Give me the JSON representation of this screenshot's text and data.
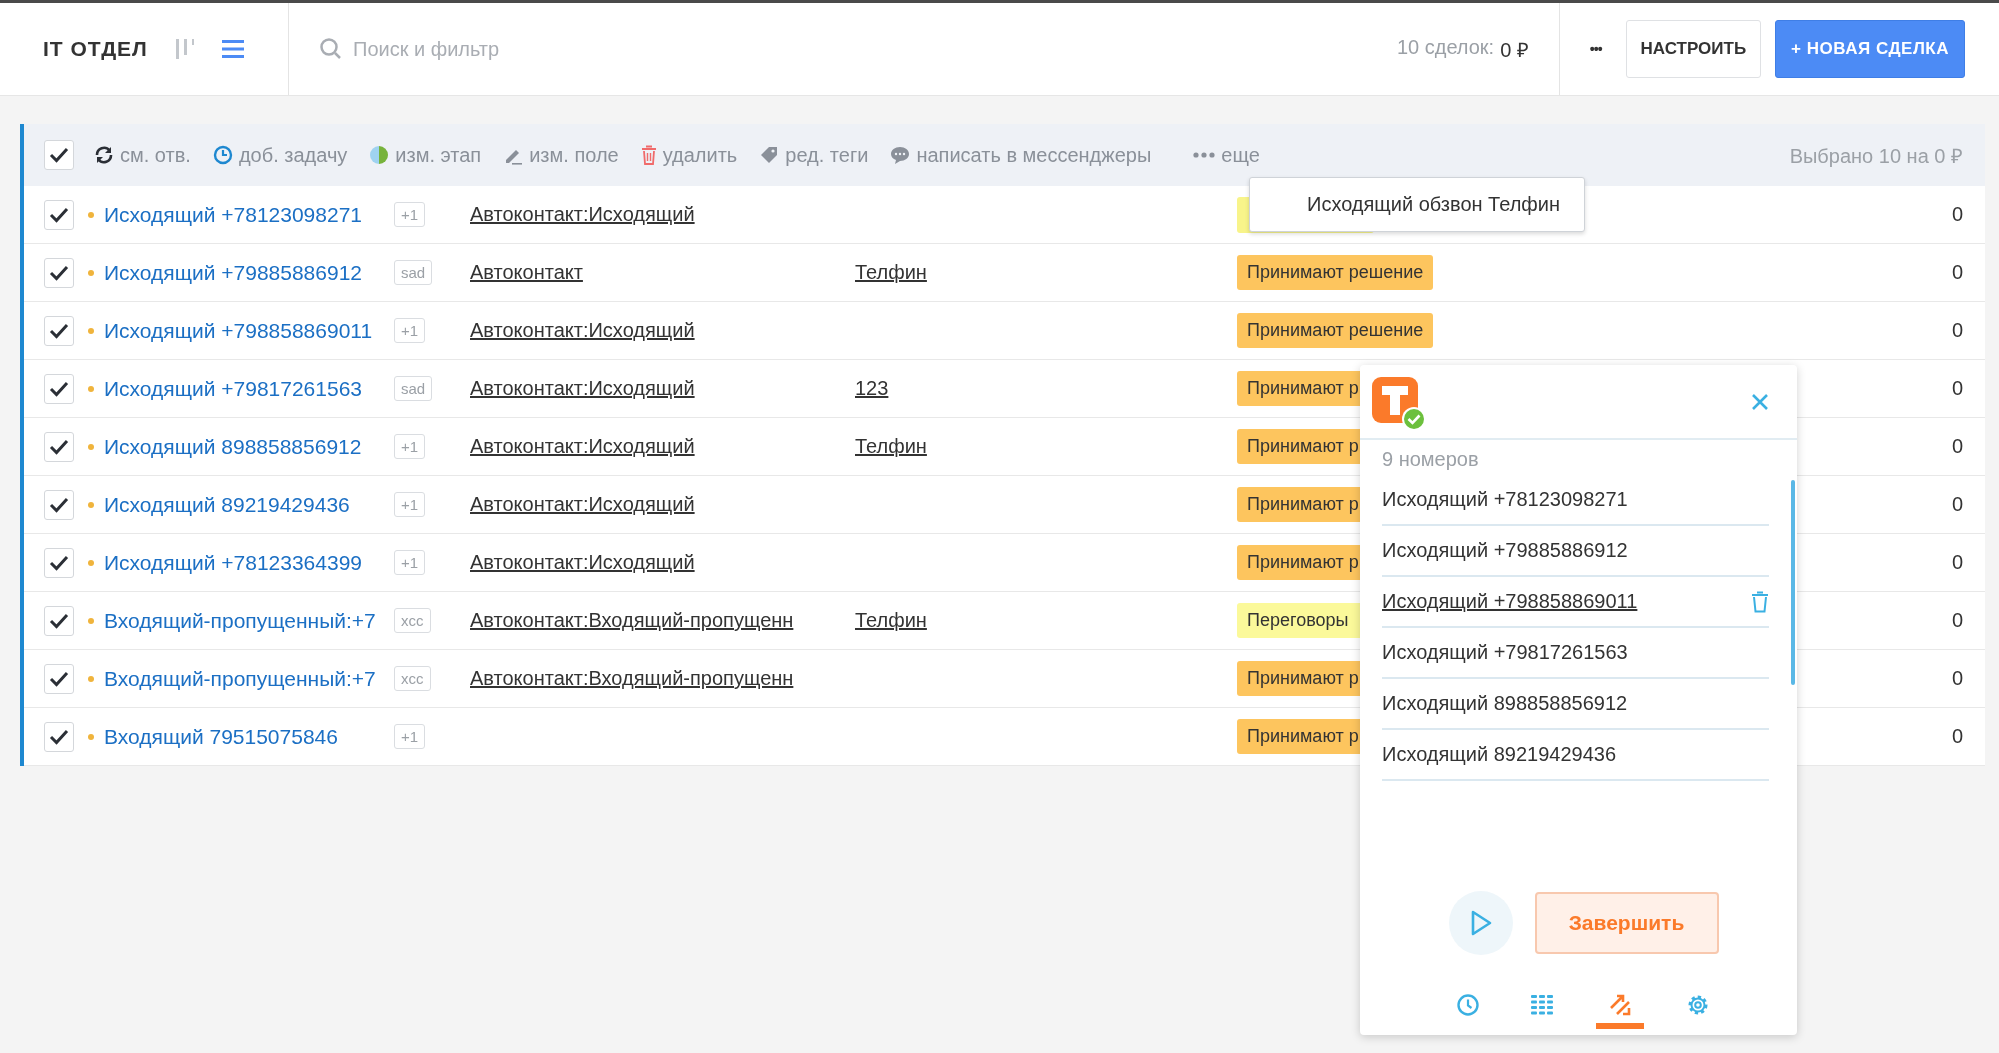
{
  "header": {
    "title": "IT ОТДЕЛ",
    "view_modes": [
      {
        "kind": "pipeline",
        "selected": false
      },
      {
        "kind": "list",
        "selected": true
      }
    ],
    "search": {
      "placeholder": "Поиск и фильтр"
    },
    "summary": {
      "label": "10 сделок:",
      "value": "0 ₽"
    },
    "more_button": "•••",
    "settings_button": "НАСТРОИТЬ",
    "new_deal_button": "+ НОВАЯ СДЕЛКА"
  },
  "bulk_toolbar": {
    "select_all_checked": true,
    "actions": [
      {
        "kind": "reassign",
        "label": "см. отв."
      },
      {
        "kind": "task",
        "label": "доб. задачу"
      },
      {
        "kind": "stage",
        "label": "изм. этап"
      },
      {
        "kind": "field",
        "label": "изм. поле"
      },
      {
        "kind": "delete",
        "label": "удалить"
      },
      {
        "kind": "tags",
        "label": "ред. теги"
      },
      {
        "kind": "messenger",
        "label": "написать в мессенджеры"
      },
      {
        "kind": "more",
        "label": "еще"
      }
    ],
    "selection_summary": "Выбрано 10 на 0 ₽"
  },
  "dropdown": {
    "items": [
      "Исходящий обзвон Телфин"
    ]
  },
  "rows": [
    {
      "checked": true,
      "name": "Исходящий +78123098271",
      "tag": "+1",
      "contact": "Автоконтакт:Исходящий",
      "column_3": "",
      "status": "",
      "color": "#f8f48a",
      "amount": "0"
    },
    {
      "checked": true,
      "name": "Исходящий +79885886912",
      "tag": "sad",
      "contact": "Автоконтакт",
      "column_3": "Телфин",
      "status": "Принимают решение",
      "color": "#fdc55e",
      "amount": "0"
    },
    {
      "checked": true,
      "name": "Исходящий +798858869011",
      "tag": "+1",
      "contact": "Автоконтакт:Исходящий",
      "column_3": "",
      "status": "Принимают решение",
      "color": "#fdc55e",
      "amount": "0"
    },
    {
      "checked": true,
      "name": "Исходящий +79817261563",
      "tag": "sad",
      "contact": "Автоконтакт:Исходящий",
      "column_3": "123",
      "status": "Принимают р",
      "color": "#fdc55e",
      "amount": "0"
    },
    {
      "checked": true,
      "name": "Исходящий 898858856912",
      "tag": "+1",
      "contact": "Автоконтакт:Исходящий",
      "column_3": "Телфин",
      "status": "Принимают р",
      "color": "#fdc55e",
      "amount": "0"
    },
    {
      "checked": true,
      "name": "Исходящий 89219429436",
      "tag": "+1",
      "contact": "Автоконтакт:Исходящий",
      "column_3": "",
      "status": "Принимают р",
      "color": "#fdc55e",
      "amount": "0"
    },
    {
      "checked": true,
      "name": "Исходящий +78123364399",
      "tag": "+1",
      "contact": "Автоконтакт:Исходящий",
      "column_3": "",
      "status": "Принимают р",
      "color": "#fdc55e",
      "amount": "0"
    },
    {
      "checked": true,
      "name": "Входящий-пропущенный:+7",
      "tag": "xcc",
      "contact": "Автоконтакт:Входящий-пропущенн",
      "column_3": "Телфин",
      "status": "Переговоры",
      "color": "#fbf99a",
      "amount": "0"
    },
    {
      "checked": true,
      "name": "Входящий-пропущенный:+7",
      "tag": "xcc",
      "contact": "Автоконтакт:Входящий-пропущенн",
      "column_3": "",
      "status": "Принимают р",
      "color": "#fdc55e",
      "amount": "0"
    },
    {
      "checked": true,
      "name": "Входящий 79515075846",
      "tag": "+1",
      "contact": "",
      "column_3": "",
      "status": "Принимают р",
      "color": "#fdc55e",
      "amount": "0"
    }
  ],
  "dialer_widget": {
    "count_label": "9 номеров",
    "numbers": [
      {
        "label": "Исходящий +78123098271",
        "hovered": false
      },
      {
        "label": "Исходящий +79885886912",
        "hovered": false
      },
      {
        "label": "Исходящий +798858869011",
        "hovered": true
      },
      {
        "label": "Исходящий +79817261563",
        "hovered": false
      },
      {
        "label": "Исходящий 898858856912",
        "hovered": false
      },
      {
        "label": "Исходящий 89219429436",
        "hovered": false
      }
    ],
    "finish_button": "Завершить",
    "tabs": [
      {
        "kind": "history",
        "selected": false
      },
      {
        "kind": "dialpad",
        "selected": false
      },
      {
        "kind": "autodial",
        "selected": true
      },
      {
        "kind": "settings",
        "selected": false
      }
    ]
  }
}
